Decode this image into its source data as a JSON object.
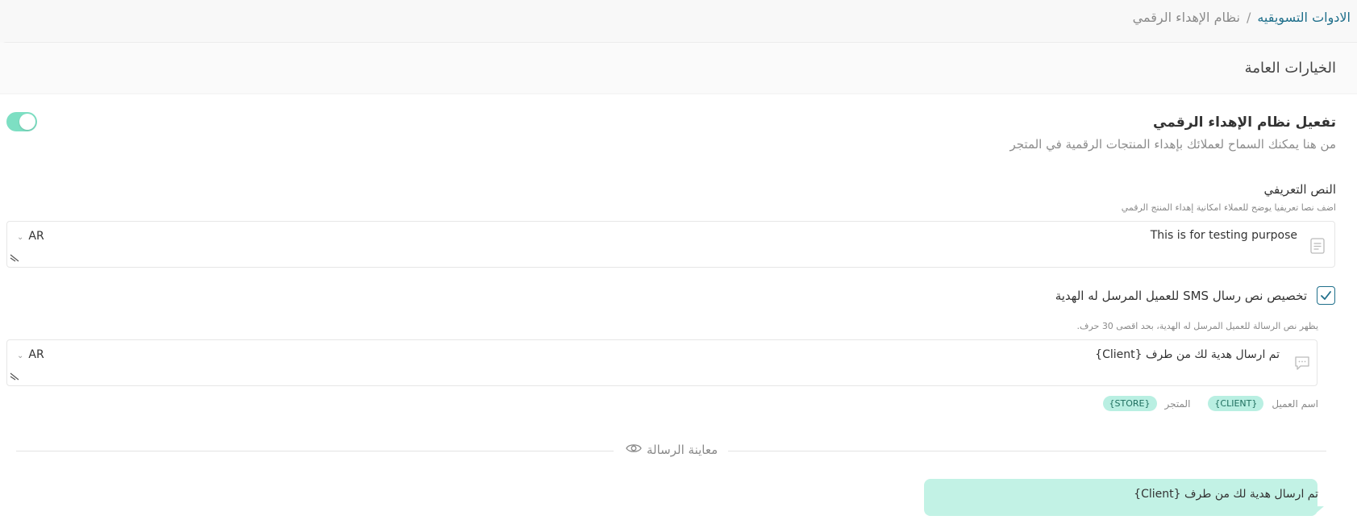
{
  "breadcrumb": {
    "parent": "الادوات التسويقيه",
    "separator": "/",
    "current": "نظام الإهداء الرقمي"
  },
  "card": {
    "title": "الخيارات العامة"
  },
  "feature": {
    "title": "تفعيل نظام الإهداء الرقمي",
    "description": "من هنا يمكنك السماح لعملائك بإهداء المنتجات الرقمية في المتجر",
    "toggle_on": true
  },
  "intro": {
    "label": "النص التعريفي",
    "hint": "اضف نصا تعريفيا يوضح للعملاء امكانية إهداء المنتج الرقمي",
    "value": "This is for testing purpose",
    "language": "AR"
  },
  "sms": {
    "title": "تخصيص نص رسال SMS للعميل المرسل له الهدية",
    "checked": true,
    "hint": "يظهر نص الرسالة للعميل المرسل له الهدية، بحد اقصى 30 حرف.",
    "value": "تم ارسال هدية لك من طرف  {Client}",
    "language": "AR"
  },
  "variables": [
    {
      "label": "اسم العميل",
      "token": "{CLIENT}"
    },
    {
      "label": "المتجر",
      "token": "{STORE}"
    }
  ],
  "preview": {
    "label": "معاينة الرسالة",
    "text": "تم ارسال هدية لك من طرف  {Client}"
  },
  "colors": {
    "accent": "#1f6f8b",
    "toggle": "#7ddfc3",
    "chip": "#b9efe2",
    "bubble": "#c2f2e5"
  }
}
